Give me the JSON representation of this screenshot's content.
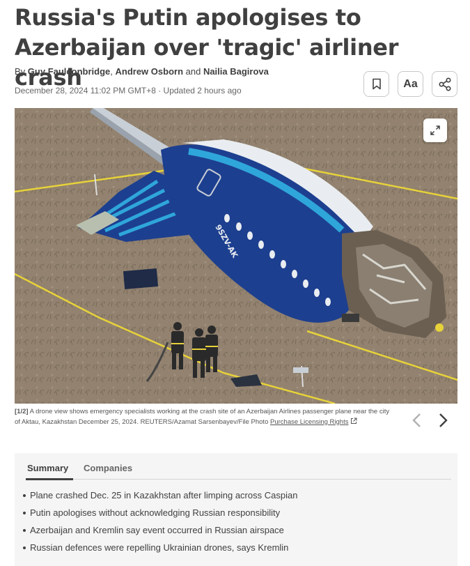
{
  "article": {
    "headline": "Russia's Putin apologises to Azerbaijan over 'tragic' airliner crash",
    "byline_prefix": "By ",
    "authors": [
      "Guy Faulconbridge",
      "Andrew Osborn",
      "Nailia Bagirova"
    ],
    "byline_sep1": ", ",
    "byline_sep2": " and ",
    "dateline": "December 28, 2024 11:02 PM GMT+8 · Updated 2 hours ago"
  },
  "toolbar": {
    "bookmark_icon": "bookmark-icon",
    "text_size_label": "Aa",
    "share_icon": "share-icon"
  },
  "photo": {
    "expand_icon": "expand-icon",
    "aircraft_registration": "9SZV-AK",
    "counter": "[1/2]",
    "caption": " A drone view shows emergency specialists working at the crash site of an Azerbaijan Airlines passenger plane near the city of Aktau, Kazakhstan December 25, 2024. REUTERS/Azamat Sarsenbayev/File Photo ",
    "licensing_link": "Purchase Licensing Rights"
  },
  "summary": {
    "tabs": [
      "Summary",
      "Companies"
    ],
    "active_tab": "Summary",
    "bullets": [
      "Plane crashed Dec. 25 in Kazakhstan after limping across Caspian",
      "Putin apologises without acknowledging Russian responsibility",
      "Azerbaijan and Kremlin say event occurred in Russian airspace",
      "Russian defences were repelling Ukrainian drones, says Kremlin"
    ]
  },
  "colors": {
    "text": "#404040",
    "fuselage_blue": "#1d3f8f",
    "stripe_cyan": "#2fa6d9",
    "ground": "#8d7d6c",
    "tape_yellow": "#e7d23a"
  }
}
